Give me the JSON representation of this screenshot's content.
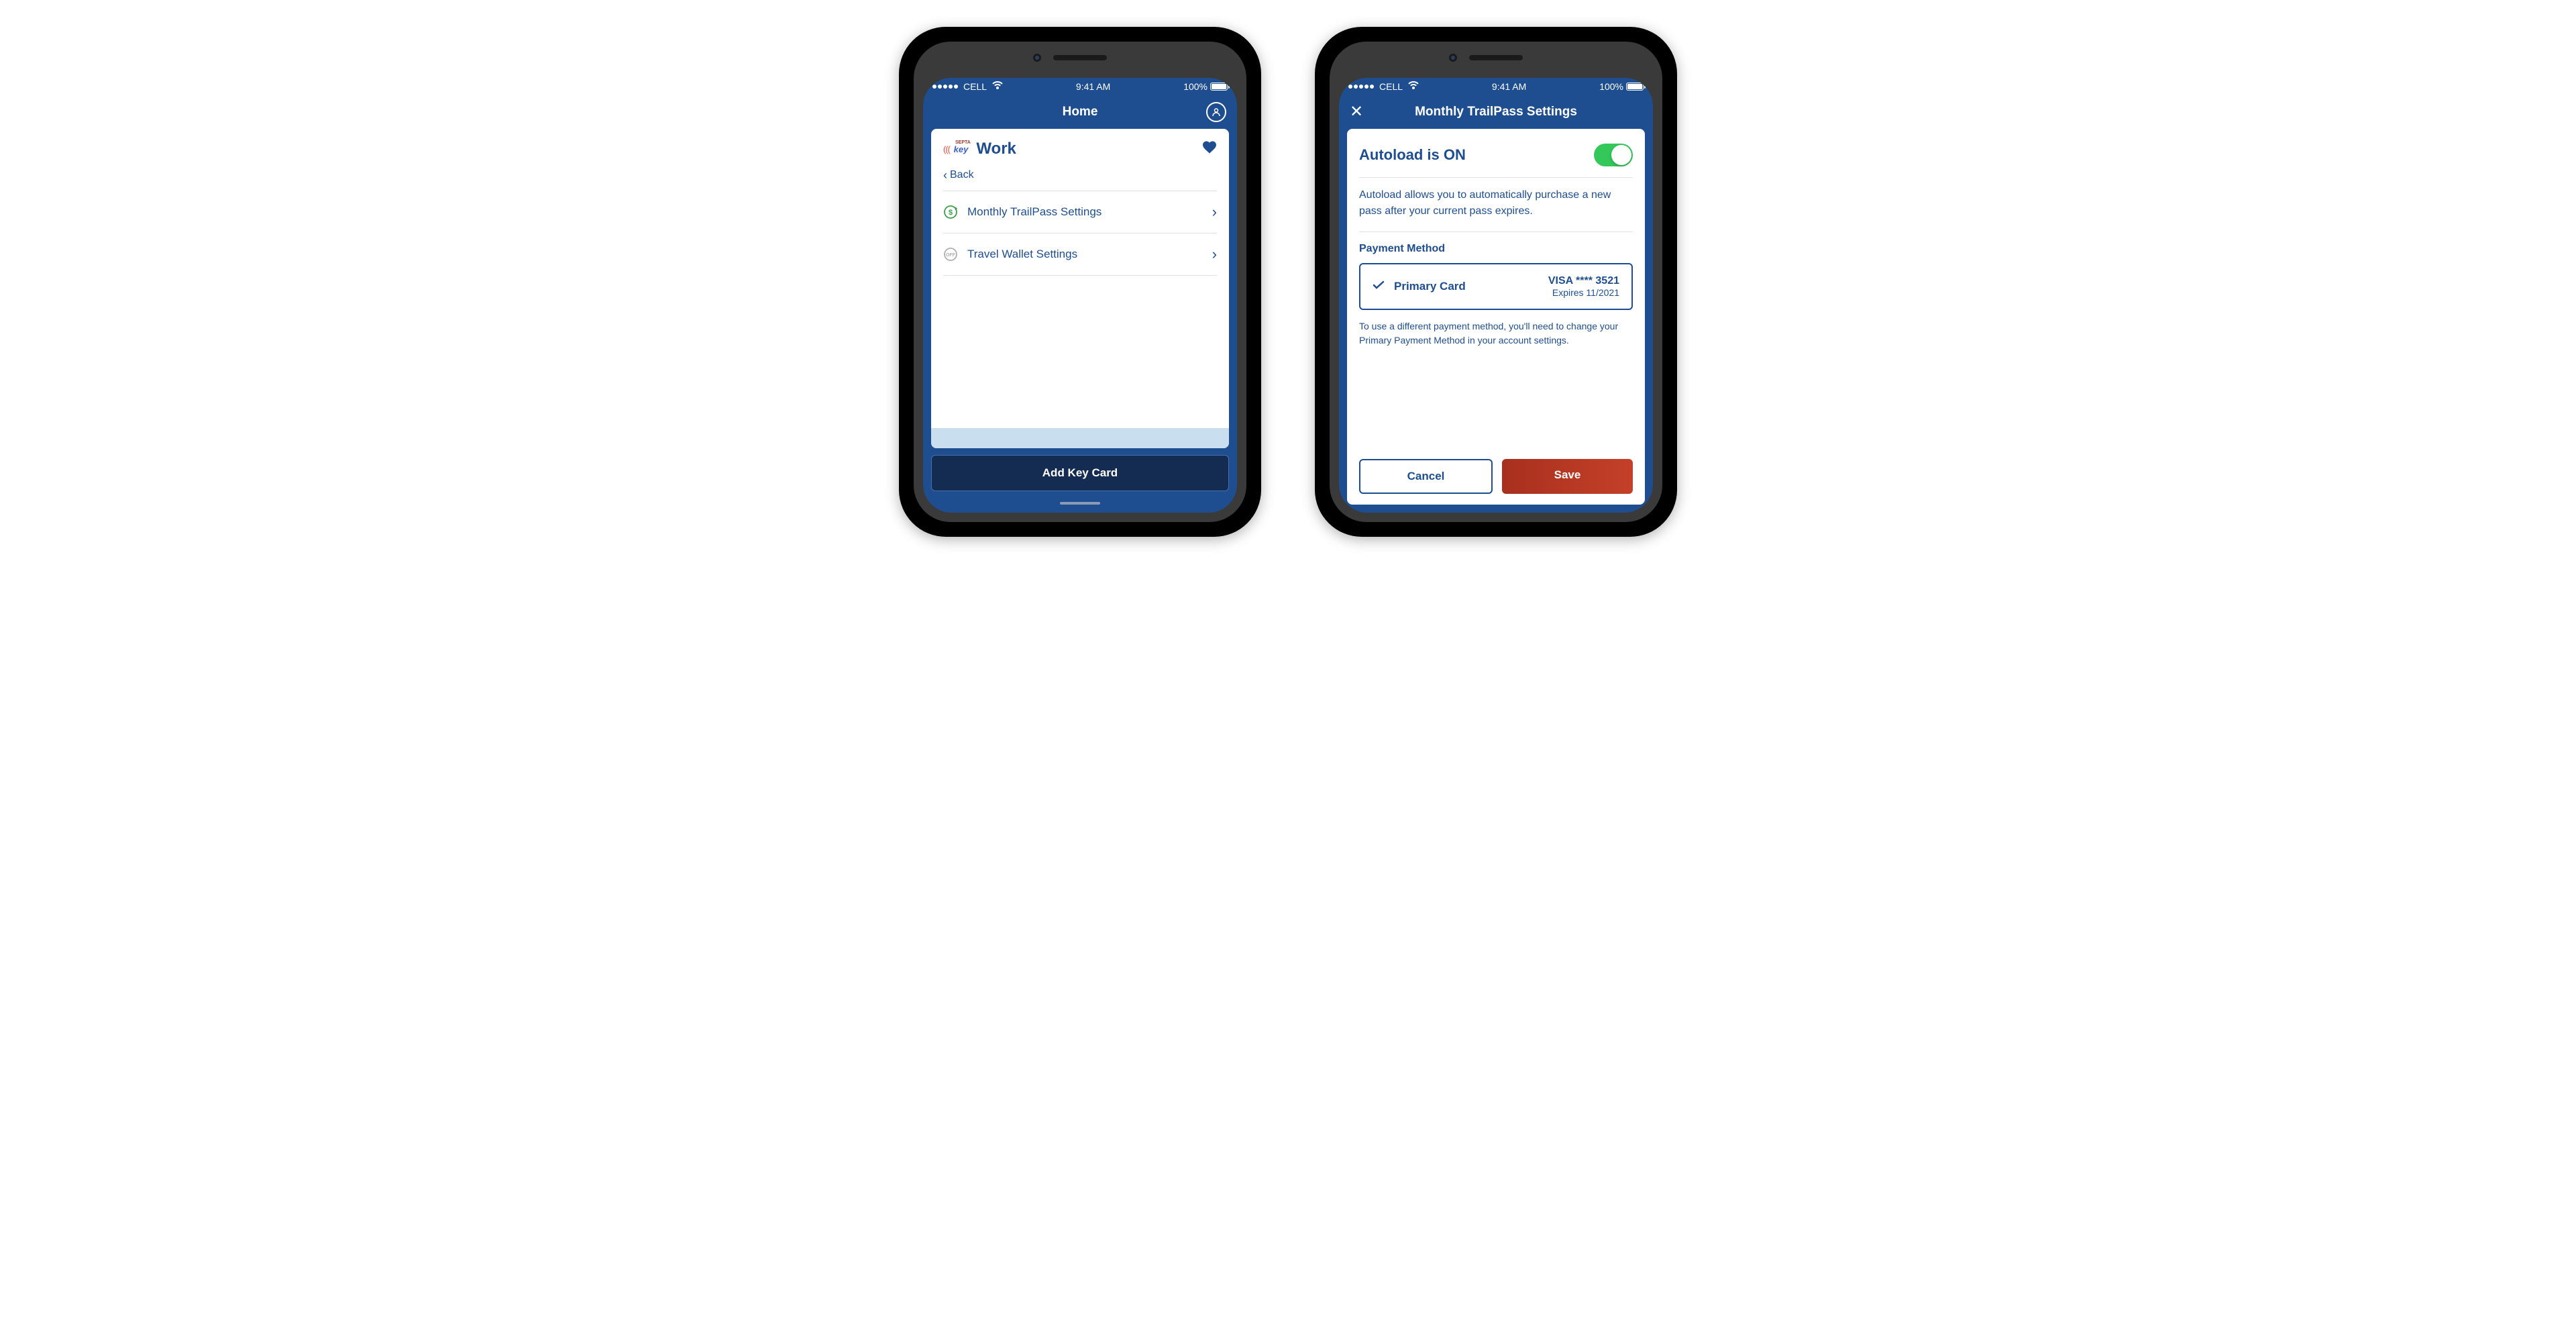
{
  "status": {
    "carrier": "CELL",
    "time": "9:41 AM",
    "battery": "100%"
  },
  "screen1": {
    "nav_title": "Home",
    "key_brand": "key",
    "septa": "SEPTA",
    "card_title": "Work",
    "back_label": "Back",
    "rows": [
      {
        "label": "Monthly TrailPass Settings"
      },
      {
        "label": "Travel Wallet Settings"
      }
    ],
    "add_button": "Add Key Card"
  },
  "screen2": {
    "nav_title": "Monthly TrailPass Settings",
    "autoload_label": "Autoload is ON",
    "autoload_on": true,
    "autoload_desc": "Autoload allows you to automatically purchase a new pass after your current pass expires.",
    "payment_section": "Payment Method",
    "payment_label": "Primary Card",
    "payment_info": "VISA **** 3521",
    "payment_exp": "Expires 11/2021",
    "help_text": "To use a different payment method, you'll need to change your Primary Payment Method in your account settings.",
    "cancel": "Cancel",
    "save": "Save"
  },
  "colors": {
    "brand_blue": "#1e4e8f",
    "dark_blue": "#142b52",
    "toggle_green": "#34c759",
    "save_red": "#b83a22"
  }
}
